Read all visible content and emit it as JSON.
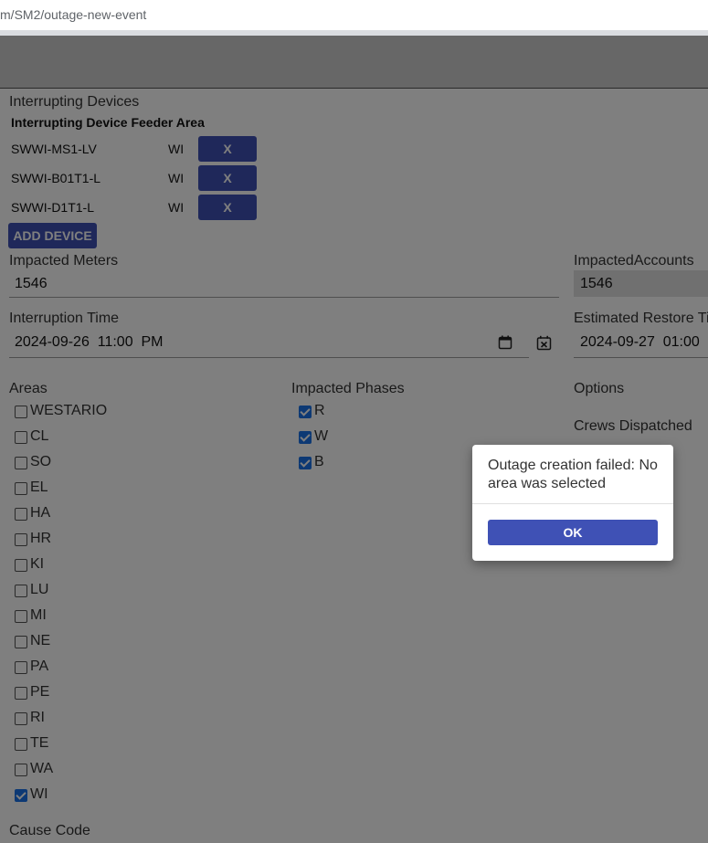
{
  "browser": {
    "url_prefix": "m/",
    "url_path": "SM2/outage-new-event"
  },
  "devices": {
    "section_title": "Interrupting Devices",
    "column_header": "Interrupting Device Feeder Area",
    "rows": [
      {
        "name": "SWWI-MS1-LV",
        "area": "WI",
        "remove_label": "X"
      },
      {
        "name": "SWWI-B01T1-L",
        "area": "WI",
        "remove_label": "X"
      },
      {
        "name": "SWWI-D1T1-L",
        "area": "WI",
        "remove_label": "X"
      }
    ],
    "add_button": "ADD DEVICE"
  },
  "meters": {
    "label": "Impacted Meters",
    "value": "1546"
  },
  "accounts": {
    "label": "ImpactedAccounts",
    "value": "1546"
  },
  "interruption": {
    "label": "Interruption Time",
    "value": "2024-09-26  11:00  PM"
  },
  "restore": {
    "label": "Estimated Restore Ti",
    "value": "2024-09-27  01:00"
  },
  "areas": {
    "label": "Areas",
    "items": [
      {
        "label": "WESTARIO",
        "checked": false
      },
      {
        "label": "CL",
        "checked": false
      },
      {
        "label": "SO",
        "checked": false
      },
      {
        "label": "EL",
        "checked": false
      },
      {
        "label": "HA",
        "checked": false
      },
      {
        "label": "HR",
        "checked": false
      },
      {
        "label": "KI",
        "checked": false
      },
      {
        "label": "LU",
        "checked": false
      },
      {
        "label": "MI",
        "checked": false
      },
      {
        "label": "NE",
        "checked": false
      },
      {
        "label": "PA",
        "checked": false
      },
      {
        "label": "PE",
        "checked": false
      },
      {
        "label": "RI",
        "checked": false
      },
      {
        "label": "TE",
        "checked": false
      },
      {
        "label": "WA",
        "checked": false
      },
      {
        "label": "WI",
        "checked": true
      }
    ]
  },
  "phases": {
    "label": "Impacted Phases",
    "items": [
      {
        "label": "R",
        "checked": true
      },
      {
        "label": "W",
        "checked": true
      },
      {
        "label": "B",
        "checked": true
      }
    ]
  },
  "options": {
    "label": "Options"
  },
  "crews": {
    "label": "Crews Dispatched"
  },
  "cause": {
    "label": "Cause Code"
  },
  "dialog": {
    "message": "Outage creation failed: No area was selected",
    "ok_label": "OK"
  },
  "colors": {
    "primary": "#3f51b5",
    "checkbox": "#1a73e8"
  }
}
